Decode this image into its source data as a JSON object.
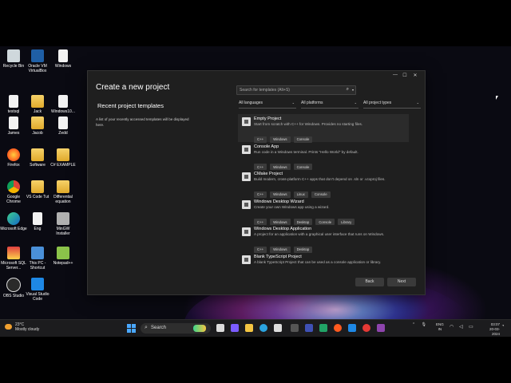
{
  "desktop": {
    "icons": [
      {
        "label": "Recycle Bin",
        "icon": "recycle-bin-icon"
      },
      {
        "label": "Oracle VM VirtualBox",
        "icon": "virtualbox-icon"
      },
      {
        "label": "Windows",
        "icon": "file-icon"
      },
      {
        "label": "testsql",
        "icon": "file-icon"
      },
      {
        "label": "Jack",
        "icon": "folder-icon"
      },
      {
        "label": "Windows10...",
        "icon": "file-icon"
      },
      {
        "label": "James",
        "icon": "file-icon"
      },
      {
        "label": "Jacob",
        "icon": "folder-icon"
      },
      {
        "label": "Zedd",
        "icon": "file-icon"
      },
      {
        "label": "Firefox",
        "icon": "firefox-icon"
      },
      {
        "label": "Software",
        "icon": "folder-icon"
      },
      {
        "label": "C# EXAMPLE",
        "icon": "folder-icon"
      },
      {
        "label": "Google Chrome",
        "icon": "chrome-icon"
      },
      {
        "label": "VS Code Tut",
        "icon": "folder-icon"
      },
      {
        "label": "Differential equation",
        "icon": "folder-icon"
      },
      {
        "label": "Microsoft Edge",
        "icon": "edge-icon"
      },
      {
        "label": "Eng",
        "icon": "file-icon"
      },
      {
        "label": "MinGW Installer",
        "icon": "installer-icon"
      },
      {
        "label": "Microsoft SQL Server...",
        "icon": "sql-server-icon"
      },
      {
        "label": "This PC - Shortcut",
        "icon": "computer-icon"
      },
      {
        "label": "Notepad++",
        "icon": "notepadpp-icon"
      },
      {
        "label": "OBS Studio",
        "icon": "obs-icon"
      },
      {
        "label": "Visual Studio Code",
        "icon": "vscode-icon"
      }
    ]
  },
  "dialog": {
    "title": "Create a new project",
    "recent_heading": "Recent project templates",
    "recent_text": "A list of your recently accessed templates will be displayed here.",
    "search_placeholder": "Search for templates (Alt+S)",
    "filters": {
      "languages": "All languages",
      "platforms": "All platforms",
      "types": "All project types"
    },
    "templates": [
      {
        "name": "Empty Project",
        "desc": "Start from scratch with C++ for Windows. Provides no starting files.",
        "tags": [
          "C++",
          "Windows",
          "Console"
        ],
        "selected": true
      },
      {
        "name": "Console App",
        "desc": "Run code in a Windows terminal. Prints \"Hello World\" by default.",
        "tags": [
          "C++",
          "Windows",
          "Console"
        ]
      },
      {
        "name": "CMake Project",
        "desc": "Build modern, cross-platform C++ apps that don't depend on .sln or .vcxproj files.",
        "tags": [
          "C++",
          "Windows",
          "Linux",
          "Console"
        ]
      },
      {
        "name": "Windows Desktop Wizard",
        "desc": "Create your own Windows app using a wizard.",
        "tags": [
          "C++",
          "Windows",
          "Desktop",
          "Console",
          "Library"
        ]
      },
      {
        "name": "Windows Desktop Application",
        "desc": "A project for an application with a graphical user interface that runs on Windows.",
        "tags": [
          "C++",
          "Windows",
          "Desktop"
        ]
      },
      {
        "name": "Blank TypeScript Project",
        "desc": "A blank TypeScript Project that can be used as a console application or library.",
        "tags": []
      }
    ],
    "back_label": "Back",
    "next_label": "Next"
  },
  "taskbar": {
    "weather_temp": "23°C",
    "weather_desc": "Mostly cloudy",
    "search_label": "Search",
    "lang_top": "ENG",
    "lang_bottom": "IN",
    "time": "03:07",
    "date": "20-03-2024"
  }
}
